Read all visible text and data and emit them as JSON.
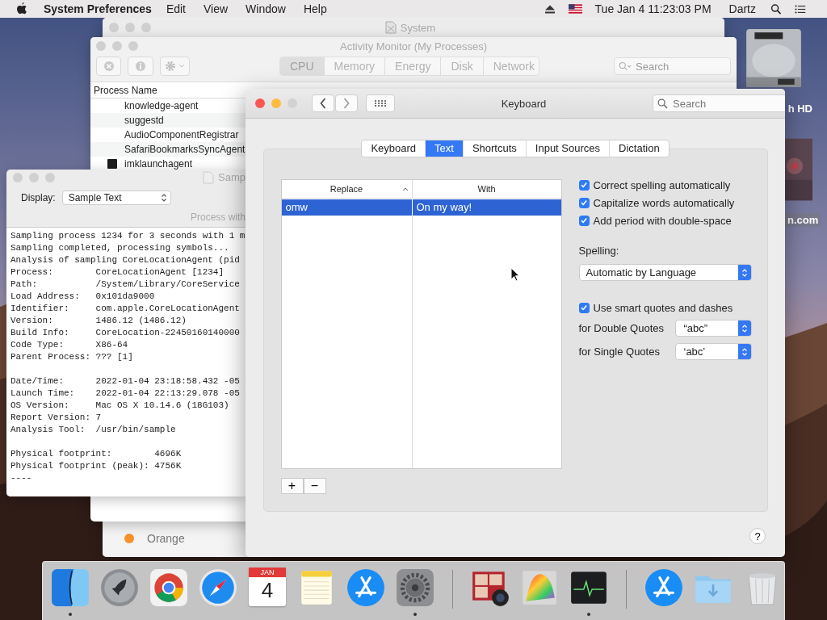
{
  "menu_bar": {
    "app": "System Preferences",
    "menus": [
      "Edit",
      "View",
      "Window",
      "Help"
    ],
    "clock": "Tue Jan 4  11:23:03 PM",
    "user": "Dartz"
  },
  "desktop_icons": [
    {
      "kind": "drive",
      "label": "h HD"
    },
    {
      "kind": "picture",
      "label": "n.com"
    }
  ],
  "system_window": {
    "title": "System",
    "labels": [
      {
        "text": "Orange",
        "color": "#f5922a"
      }
    ]
  },
  "activity_monitor": {
    "title": "Activity Monitor (My Processes)",
    "tabs": [
      {
        "label": "CPU",
        "selected": true
      },
      {
        "label": "Memory",
        "selected": false
      },
      {
        "label": "Energy",
        "selected": false
      },
      {
        "label": "Disk",
        "selected": false
      },
      {
        "label": "Network",
        "selected": false
      }
    ],
    "search_placeholder": "Search",
    "column": "Process Name",
    "processes": [
      {
        "name": "knowledge-agent",
        "has_icon": false
      },
      {
        "name": "suggestd",
        "has_icon": false
      },
      {
        "name": "AudioComponentRegistrar",
        "has_icon": false
      },
      {
        "name": "SafariBookmarksSyncAgent",
        "has_icon": false
      },
      {
        "name": "imklaunchagent",
        "has_icon": true
      }
    ]
  },
  "sample_window": {
    "title": "Samp",
    "display_label": "Display:",
    "display_value": "Sample Text",
    "caption": "Process with",
    "blocks": [
      [
        "Sampling process 1234 for 3 seconds with 1 m",
        "Sampling completed, processing symbols...",
        "Analysis of sampling CoreLocationAgent (pid",
        "Process:        CoreLocationAgent [1234]",
        "Path:           /System/Library/CoreService",
        "Load Address:   0x101da9000",
        "Identifier:     com.apple.CoreLocationAgent",
        "Version:        1486.12 (1486.12)",
        "Build Info:     CoreLocation-22450160140000",
        "Code Type:      X86-64",
        "Parent Process: ??? [1]"
      ],
      [
        "Date/Time:      2022-01-04 23:18:58.432 -05",
        "Launch Time:    2022-01-04 22:13:29.078 -05",
        "OS Version:     Mac OS X 10.14.6 (18G103)",
        "Report Version: 7",
        "Analysis Tool:  /usr/bin/sample"
      ],
      [
        "Physical footprint:        4696K",
        "Physical footprint (peak): 4756K",
        "----"
      ]
    ]
  },
  "keyboard_window": {
    "title": "Keyboard",
    "search_placeholder": "Search",
    "tabs": [
      {
        "label": "Keyboard",
        "selected": false
      },
      {
        "label": "Text",
        "selected": true
      },
      {
        "label": "Shortcuts",
        "selected": false
      },
      {
        "label": "Input Sources",
        "selected": false
      },
      {
        "label": "Dictation",
        "selected": false
      }
    ],
    "table": {
      "columns": [
        "Replace",
        "With"
      ],
      "rows": [
        {
          "replace": "omw",
          "with": "On my way!",
          "selected": true
        }
      ]
    },
    "add_button": "+",
    "remove_button": "−",
    "options": [
      {
        "label": "Correct spelling automatically",
        "checked": true
      },
      {
        "label": "Capitalize words automatically",
        "checked": true
      },
      {
        "label": "Add period with double-space",
        "checked": true
      }
    ],
    "spelling_label": "Spelling:",
    "spelling_value": "Automatic by Language",
    "smart_quotes": {
      "label": "Use smart quotes and dashes",
      "checked": true
    },
    "quote_rows": [
      {
        "label": "for Double Quotes",
        "value": "“abc”"
      },
      {
        "label": "for Single Quotes",
        "value": "‘abc’"
      }
    ],
    "help_button": "?"
  },
  "dock": {
    "items": [
      {
        "kind": "finder",
        "running": true
      },
      {
        "kind": "launchpad",
        "running": false
      },
      {
        "kind": "chrome",
        "running": false
      },
      {
        "kind": "safari",
        "running": false
      },
      {
        "kind": "calendar",
        "running": false,
        "month": "JAN",
        "day": "4"
      },
      {
        "kind": "notes",
        "running": false
      },
      {
        "kind": "appstore",
        "running": false
      },
      {
        "kind": "settings",
        "running": true
      },
      {
        "kind": "separator"
      },
      {
        "kind": "photobooth",
        "running": false
      },
      {
        "kind": "grapher",
        "running": false
      },
      {
        "kind": "monitor",
        "running": true
      },
      {
        "kind": "separator"
      },
      {
        "kind": "appstore",
        "running": false
      },
      {
        "kind": "folder",
        "running": false
      },
      {
        "kind": "trash",
        "running": false
      }
    ]
  }
}
